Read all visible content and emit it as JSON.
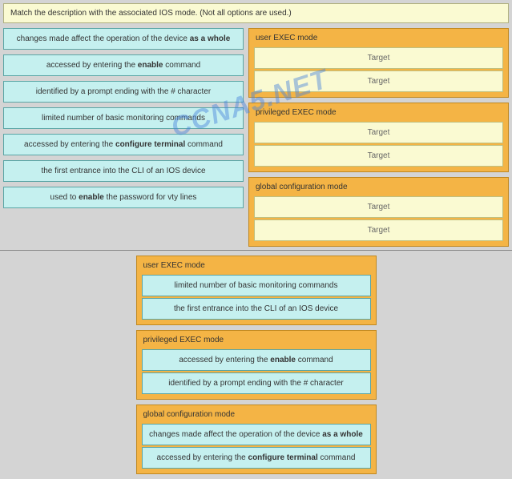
{
  "question": "Match the description with the associated IOS mode. (Not all options are used.)",
  "watermark": "CCNA5.NET",
  "drag_items": [
    "changes made affect the operation of the device as a whole",
    "accessed by entering the enable command",
    "identified by a prompt ending with the # character",
    "limited number of basic monitoring commands",
    "accessed by entering the configure terminal command",
    "the first entrance into the CLI of an IOS device",
    "used to enable the password for vty lines"
  ],
  "drop_groups": [
    {
      "title": "user EXEC mode",
      "slots": [
        "Target",
        "Target"
      ]
    },
    {
      "title": "privileged EXEC mode",
      "slots": [
        "Target",
        "Target"
      ]
    },
    {
      "title": "global configuration mode",
      "slots": [
        "Target",
        "Target"
      ]
    }
  ],
  "answers": [
    {
      "title": "user EXEC mode",
      "items": [
        "limited number of basic monitoring commands",
        "the first entrance into the CLI of an IOS device"
      ]
    },
    {
      "title": "privileged EXEC mode",
      "items": [
        "accessed by entering the enable command",
        "identified by a prompt ending with the # character"
      ]
    },
    {
      "title": "global configuration mode",
      "items": [
        "changes made affect the operation of the device as a whole",
        "accessed by entering the configure terminal command"
      ]
    }
  ],
  "bold_phrases": [
    "enable",
    "configure terminal",
    "as a whole"
  ]
}
